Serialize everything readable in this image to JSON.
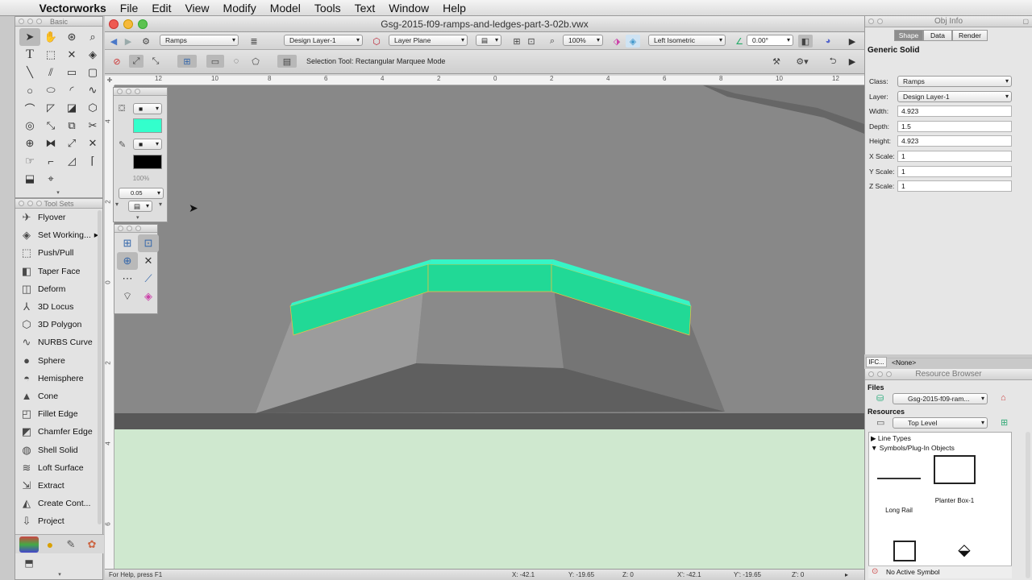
{
  "menubar": {
    "items": [
      "Vectorworks",
      "File",
      "Edit",
      "View",
      "Modify",
      "Model",
      "Tools",
      "Text",
      "Window",
      "Help"
    ]
  },
  "basic_palette": {
    "title": "Basic"
  },
  "toolsets": {
    "title": "Tool Sets",
    "items": [
      {
        "label": "Flyover",
        "icon": "flyover-icon",
        "glyph": "✈"
      },
      {
        "label": "Set Working...",
        "icon": "working-plane-icon",
        "glyph": "◈",
        "arrow": "▶"
      },
      {
        "label": "Push/Pull",
        "icon": "push-pull-icon",
        "glyph": "⬚"
      },
      {
        "label": "Taper Face",
        "icon": "taper-face-icon",
        "glyph": "◧"
      },
      {
        "label": "Deform",
        "icon": "deform-icon",
        "glyph": "◫"
      },
      {
        "label": "3D Locus",
        "icon": "locus-icon",
        "glyph": "⅄"
      },
      {
        "label": "3D Polygon",
        "icon": "polygon-icon",
        "glyph": "⬡"
      },
      {
        "label": "NURBS Curve",
        "icon": "nurbs-icon",
        "glyph": "∿"
      },
      {
        "label": "Sphere",
        "icon": "sphere-icon",
        "glyph": "●"
      },
      {
        "label": "Hemisphere",
        "icon": "hemisphere-icon",
        "glyph": "◓"
      },
      {
        "label": "Cone",
        "icon": "cone-icon",
        "glyph": "▲"
      },
      {
        "label": "Fillet Edge",
        "icon": "fillet-icon",
        "glyph": "◰"
      },
      {
        "label": "Chamfer Edge",
        "icon": "chamfer-icon",
        "glyph": "◩"
      },
      {
        "label": "Shell Solid",
        "icon": "shell-icon",
        "glyph": "◍"
      },
      {
        "label": "Loft Surface",
        "icon": "loft-icon",
        "glyph": "≋"
      },
      {
        "label": "Extract",
        "icon": "extract-icon",
        "glyph": "⇲"
      },
      {
        "label": "Create Cont...",
        "icon": "contour-icon",
        "glyph": "◭"
      },
      {
        "label": "Project",
        "icon": "project-icon",
        "glyph": "⇩"
      }
    ]
  },
  "document": {
    "title": "Gsg-2015-f09-ramps-and-ledges-part-3-02b.vwx",
    "class_popup": "Ramps",
    "layer_popup": "Design Layer-1",
    "plane_popup": "Layer Plane",
    "zoom": "100%",
    "view_popup": "Left Isometric",
    "rotation": "0.00°",
    "mode_hint": "Selection Tool: Rectangular Marquee Mode",
    "status_help": "For Help, press F1",
    "status": {
      "x1": "X: -42.1",
      "y1": "Y: -19.65",
      "z1": "Z: 0",
      "x2": "X': -42.1",
      "y2": "Y': -19.65",
      "z2": "Z': 0"
    },
    "ruler_ticks": [
      "12",
      "10",
      "8",
      "6",
      "4",
      "2",
      "0",
      "2",
      "4",
      "6",
      "8",
      "10",
      "12"
    ],
    "vruler_ticks": [
      "4",
      "2",
      "0",
      "2",
      "4",
      "6"
    ]
  },
  "attributes": {
    "fill_color": "#33ffcc",
    "pen_color": "#000000",
    "opacity": "100%",
    "line_weight": "0.05"
  },
  "colors": {
    "ramp_face": "#21d996",
    "ramp_top": "#36f5c6",
    "ground": "#cfe8cf",
    "viewport_bg": "#888888"
  },
  "obj_info": {
    "title": "Obj Info",
    "tabs": [
      "Shape",
      "Data",
      "Render"
    ],
    "object_type": "Generic Solid",
    "fields": [
      {
        "label": "Class:",
        "value": "Ramps",
        "popup": true
      },
      {
        "label": "Layer:",
        "value": "Design Layer-1",
        "popup": true
      },
      {
        "label": "Width:",
        "value": "4.923"
      },
      {
        "label": "Depth:",
        "value": "1.5"
      },
      {
        "label": "Height:",
        "value": "4.923"
      },
      {
        "label": "X Scale:",
        "value": "1"
      },
      {
        "label": "Y Scale:",
        "value": "1"
      },
      {
        "label": "Z Scale:",
        "value": "1"
      }
    ],
    "ifc_label": "IFC...",
    "ifc_value": "<None>"
  },
  "resource_browser": {
    "title": "Resource Browser",
    "files_label": "Files",
    "file_popup": "Gsg-2015-f09-ram...",
    "resources_label": "Resources",
    "resources_popup": "Top Level",
    "tree": [
      "Line Types",
      "Symbols/Plug-In Objects"
    ],
    "symbols": [
      {
        "label": "Long Rail"
      },
      {
        "label": "Planter Box-1"
      }
    ],
    "status": "No Active Symbol"
  }
}
